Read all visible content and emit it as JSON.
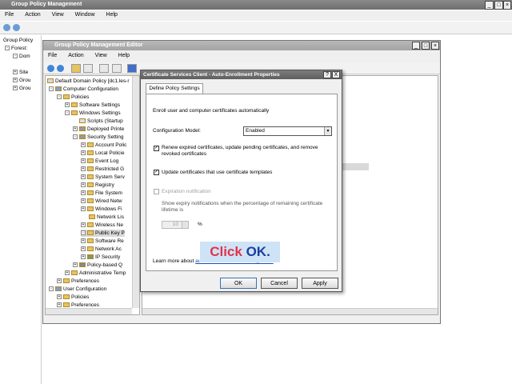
{
  "outer": {
    "title": "Group Policy Management",
    "menu": [
      "File",
      "Action",
      "View",
      "Window",
      "Help"
    ],
    "tree": [
      "Group Policy",
      "Forest:",
      "Dom",
      "Site",
      "Grou",
      "Grou"
    ]
  },
  "editor": {
    "title": "Group Policy Management Editor",
    "menu": [
      "File",
      "Action",
      "View",
      "Help"
    ],
    "tree": [
      "Default Domain Policy [dc1.les-r",
      "Computer Configuration",
      "Policies",
      "Software Settings",
      "Windows Settings",
      "Scripts (Startup",
      "Deployed Printe",
      "Security Setting",
      "Account Polic",
      "Local Policie",
      "Event Log",
      "Restricted G",
      "System Serv",
      "Registry",
      "File System",
      "Wired Netw",
      "Windows Fi",
      "Network Lis",
      "Wireless Ne",
      "Public Key P",
      "Software Re",
      "Network Ac",
      "IP Security",
      "Policy-based Q",
      "Administrative Temp",
      "Preferences",
      "User Configuration",
      "Policies",
      "Preferences"
    ]
  },
  "dialog": {
    "title": "Certificate Services Client - Auto-Enrollment Properties",
    "help_btn": "?",
    "close_btn": "X",
    "tab": "Define Policy Settings",
    "description": "Enroll user and computer certificates automatically",
    "config_label": "Configuration Model:",
    "config_value": "Enabled",
    "renew_label": "Renew expired certificates, update pending certificates, and remove revoked certificates",
    "renew_checked": true,
    "update_label": "Update certificates that use certificate templates",
    "update_checked": true,
    "expiry_label": "Expiration notification",
    "expiry_checked": false,
    "expiry_desc": "Show expiry notifications when the percentage of remaining certificate lifetime is",
    "percent_value": "10",
    "percent_sign": "%",
    "learn_more_prefix": "Learn more about ",
    "learn_more_link": "automatic certificate management",
    "ok": "OK",
    "cancel": "Cancel",
    "apply": "Apply"
  },
  "callout": {
    "prefix": "Click ",
    "highlight": "OK",
    "suffix": ".",
    "highlight_color": "#1a3f9c",
    "prefix_color": "#e0344a"
  }
}
